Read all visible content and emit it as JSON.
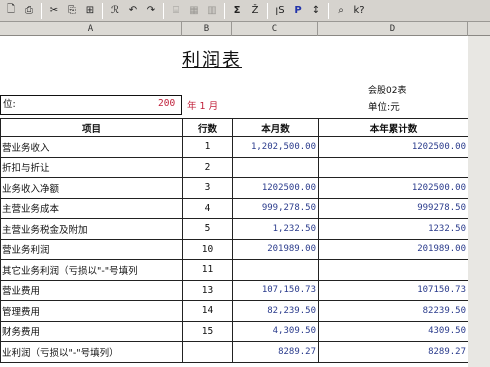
{
  "toolbar": {
    "icons": [
      "new-file-icon",
      "print-icon",
      "cut-icon",
      "copy-icon",
      "paste-icon",
      "format-painter-icon",
      "undo-icon",
      "redo-icon",
      "font-icon",
      "border-icon",
      "merge-icon",
      "sum-icon",
      "sort-icon",
      "chart-icon",
      "p-icon",
      "filter-icon",
      "zoom-icon",
      "help-icon"
    ],
    "glyphs": [
      "🗋",
      "⎙",
      "✂",
      "⎘",
      "⊞",
      "ℛ",
      "↶",
      "↷",
      "⌸",
      "▦",
      "▥",
      "Σ",
      "Ž",
      "ꞁS",
      "P",
      "↕",
      "⌕",
      "k?"
    ]
  },
  "columns": [
    {
      "label": "A"
    },
    {
      "label": "B"
    },
    {
      "label": "C"
    },
    {
      "label": "D"
    }
  ],
  "report": {
    "title": "利润表",
    "code": "会股02表",
    "unit_dept_label": "位:",
    "year_value": "200",
    "year_suffix": "年 1 月",
    "currency_unit": "单位:元",
    "headers": {
      "item": "项目",
      "line": "行数",
      "month": "本月数",
      "ytd": "本年累计数"
    },
    "rows": [
      {
        "item": "营业务收入",
        "line": "1",
        "month": "1,202,500.00",
        "ytd": "1202500.00"
      },
      {
        "item": "折扣与折让",
        "line": "2",
        "month": "",
        "ytd": ""
      },
      {
        "item": "业务收入净额",
        "line": "3",
        "month": "1202500.00",
        "ytd": "1202500.00"
      },
      {
        "item": "主营业务成本",
        "line": "4",
        "month": "999,278.50",
        "ytd": "999278.50"
      },
      {
        "item": "主营业务税金及附加",
        "line": "5",
        "month": "1,232.50",
        "ytd": "1232.50"
      },
      {
        "item": "营业务利润",
        "line": "10",
        "month": "201989.00",
        "ytd": "201989.00"
      },
      {
        "item": "其它业务利润（亏损以\"-\"号填列",
        "line": "11",
        "month": "",
        "ytd": ""
      },
      {
        "item": "营业费用",
        "line": "13",
        "month": "107,150.73",
        "ytd": "107150.73"
      },
      {
        "item": "管理费用",
        "line": "14",
        "month": "82,239.50",
        "ytd": "82239.50"
      },
      {
        "item": "财务费用",
        "line": "15",
        "month": "4,309.50",
        "ytd": "4309.50"
      },
      {
        "item": "业利润（亏损以\"-\"号填列）",
        "line": "",
        "month": "8289.27",
        "ytd": "8289.27"
      }
    ]
  },
  "colors": {
    "accent_red": "#c0203a",
    "number_blue": "#2a3b8c",
    "chrome": "#d6d3ce"
  }
}
